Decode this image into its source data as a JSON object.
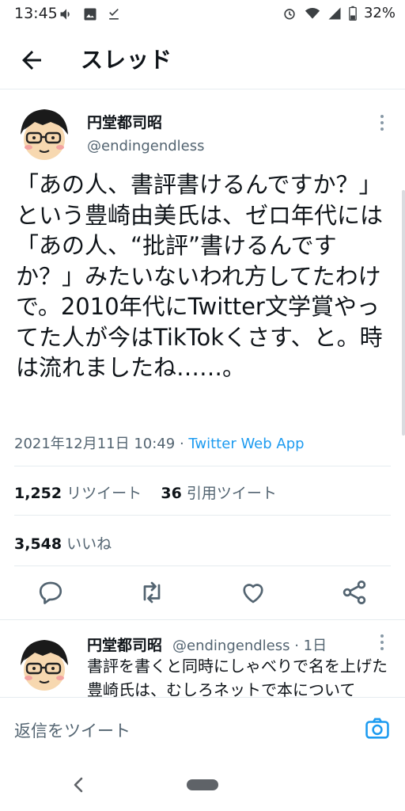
{
  "status_bar": {
    "time": "13:45",
    "battery": "32%"
  },
  "header": {
    "title": "スレッド"
  },
  "tweet": {
    "author_name": "円堂都司昭",
    "author_handle": "@endingendless",
    "text": "「あの人、書評書けるんですか？」という豊崎由美氏は、ゼロ年代には「あの人、“批評”書けるんですか？」みたいないわれ方してたわけで。2010年代にTwitter文学賞やってた人が今はTikTokくさす、と。時は流れましたね……。",
    "timestamp": "2021年12月11日 10:49",
    "separator": " · ",
    "source_app": "Twitter Web App",
    "retweets_count": "1,252",
    "retweets_label": "リツイート",
    "quotes_count": "36",
    "quotes_label": "引用ツイート",
    "likes_count": "3,548",
    "likes_label": "いいね"
  },
  "reply": {
    "author_name": "円堂都司昭",
    "meta": "@endingendless · 1日",
    "text": "書評を書くと同時にしゃべりで名を上げた豊崎氏は、むしろネットで本について"
  },
  "compose": {
    "placeholder": "返信をツイート"
  },
  "colors": {
    "accent": "#1d9bf0",
    "text": "#0f1419",
    "secondary": "#536471",
    "divider": "#e6ecf0"
  }
}
